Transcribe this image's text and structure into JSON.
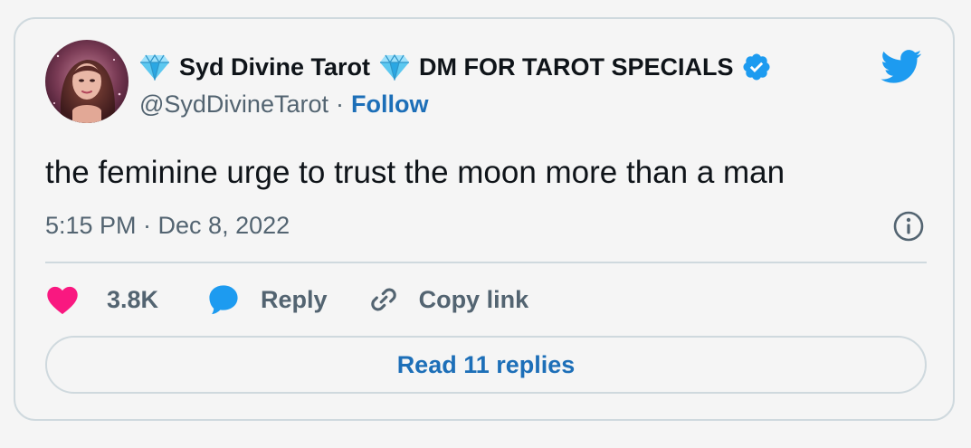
{
  "colors": {
    "accent": "#1d6fb8",
    "verified": "#1d9bf0",
    "twitter_bird": "#1d9bf0",
    "like_heart": "#f91880",
    "reply_bubble": "#1d9bf0",
    "gem": "#5cc8f0",
    "muted_text": "#536471",
    "border": "#cfd9de",
    "background": "#f5f5f5"
  },
  "author": {
    "gem_icon": "gem-icon",
    "name": "Syd Divine Tarot",
    "name_suffix": "DM FOR TAROT SPECIALS",
    "verified_icon": "verified-badge-icon",
    "handle": "@SydDivineTarot",
    "separator": "·",
    "follow_label": "Follow"
  },
  "brand": {
    "icon": "twitter-bird-icon"
  },
  "tweet": {
    "text": "the feminine urge to trust the moon more than a man",
    "timestamp": "5:15 PM · Dec 8, 2022",
    "info_icon": "info-icon"
  },
  "actions": {
    "like_count": "3.8K",
    "like_icon": "heart-icon",
    "reply_label": "Reply",
    "reply_icon": "speech-bubble-icon",
    "copy_link_label": "Copy link",
    "copy_link_icon": "link-icon"
  },
  "footer": {
    "read_replies_label": "Read 11 replies"
  }
}
